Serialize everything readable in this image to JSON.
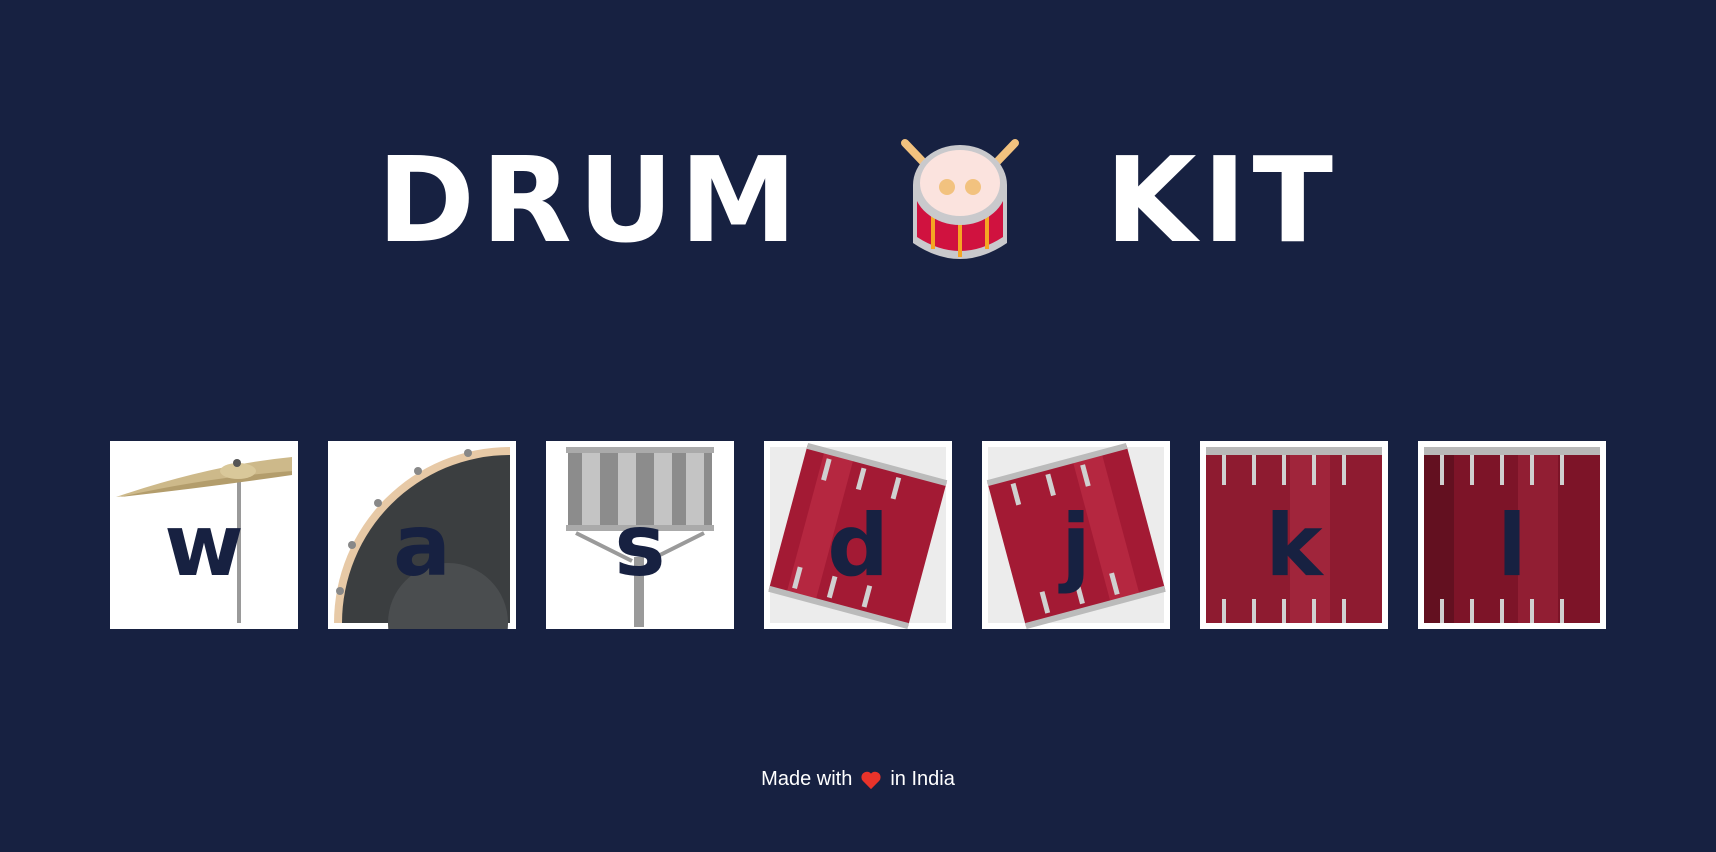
{
  "header": {
    "title_left": "DRUM",
    "title_right": "KIT",
    "icon": "drum-icon"
  },
  "drums": [
    {
      "key": "w",
      "image": "crash-cymbal"
    },
    {
      "key": "a",
      "image": "bass-drum"
    },
    {
      "key": "s",
      "image": "snare-drum"
    },
    {
      "key": "d",
      "image": "tom-1"
    },
    {
      "key": "j",
      "image": "tom-2"
    },
    {
      "key": "k",
      "image": "tom-3"
    },
    {
      "key": "l",
      "image": "tom-4"
    }
  ],
  "footer": {
    "prefix": "Made with",
    "icon": "heart-icon",
    "suffix": "in India"
  },
  "colors": {
    "background": "#172141",
    "tile": "#ffffff",
    "key_text": "#172141",
    "heart": "#e8332a",
    "drum_red": "#a81f3a"
  }
}
